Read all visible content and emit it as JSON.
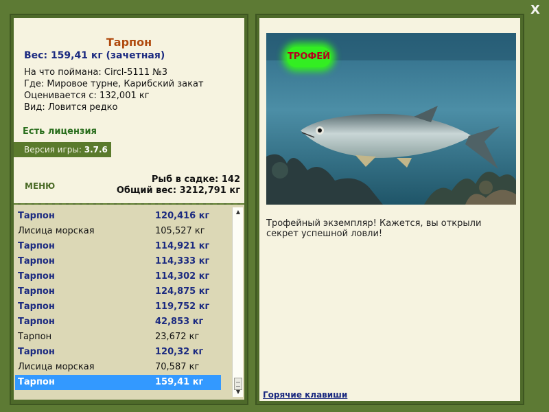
{
  "window": {
    "close_label": "X"
  },
  "fish": {
    "title": "Тарпон",
    "weight_line": "Вес: 159,41 кг (зачетная)",
    "bait": "На что поймана: Circl-5111 №3",
    "location": "Где: Мировое турне, Карибский закат",
    "evaluated": "Оценивается с: 132,001 кг",
    "type": "Вид: Ловится редко"
  },
  "license": "Есть лицензия",
  "version": {
    "label": "Версия игры: ",
    "value": "3.7.6"
  },
  "menu_label": "МЕНЮ",
  "stats": {
    "count": "Рыб в садке: 142",
    "total": "Общий вес: 3212,791 кг"
  },
  "catch_list": [
    {
      "name": "Тарпон",
      "weight": "120,416 кг",
      "trophy": true
    },
    {
      "name": "Лисица морская",
      "weight": "105,527 кг",
      "trophy": false
    },
    {
      "name": "Тарпон",
      "weight": "114,921 кг",
      "trophy": true
    },
    {
      "name": "Тарпон",
      "weight": "114,333 кг",
      "trophy": true
    },
    {
      "name": "Тарпон",
      "weight": "114,302 кг",
      "trophy": true
    },
    {
      "name": "Тарпон",
      "weight": "124,875 кг",
      "trophy": true
    },
    {
      "name": "Тарпон",
      "weight": "119,752 кг",
      "trophy": true
    },
    {
      "name": "Тарпон",
      "weight": "42,853 кг",
      "trophy": true
    },
    {
      "name": "Тарпон",
      "weight": "23,672 кг",
      "trophy": false
    },
    {
      "name": "Тарпон",
      "weight": "120,32 кг",
      "trophy": true
    },
    {
      "name": "Лисица морская",
      "weight": "70,587 кг",
      "trophy": false
    },
    {
      "name": "Тарпон",
      "weight": "159,41 кг",
      "trophy": true,
      "selected": true
    }
  ],
  "photo": {
    "badge": "ТРОФЕЙ"
  },
  "description": "Трофейный экземпляр! Кажется, вы открыли секрет успешной ловли!",
  "hotkeys_label": "Горячие клавиши",
  "colors": {
    "frame": "#5d7a34",
    "panel_bg": "#f6f3e0",
    "list_bg": "#dcd8b6",
    "title": "#b04a0e",
    "trophy_text": "#1b2a80",
    "selection": "#3399ff",
    "badge": "#33ee22"
  }
}
